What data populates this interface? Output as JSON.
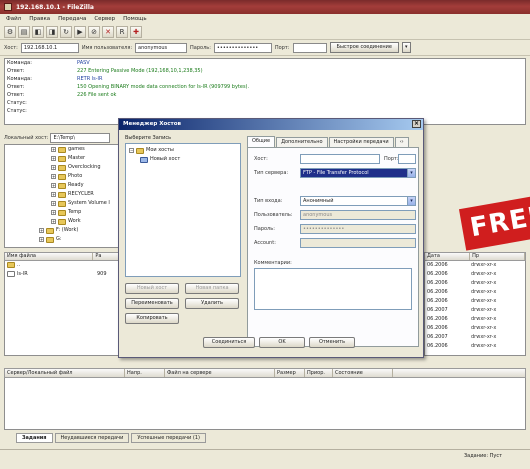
{
  "window": {
    "title": "192.168.10.1 - FileZilla"
  },
  "menu": [
    "Файл",
    "Правка",
    "Передача",
    "Сервер",
    "Помощь"
  ],
  "quickconnect": {
    "host_label": "Хост:",
    "host_value": "192.168.10.1",
    "user_label": "Имя пользователя:",
    "user_value": "anonymous",
    "pass_label": "Пароль:",
    "pass_value": "••••••••••••••",
    "port_label": "Порт:",
    "port_value": "",
    "button": "Быстрое соединение"
  },
  "log": [
    {
      "k": "Команда:",
      "v": "PASV",
      "c": "b"
    },
    {
      "k": "Ответ:",
      "v": "227 Entering Passive Mode (192,168,10,1,238,35)",
      "c": "g"
    },
    {
      "k": "Команда:",
      "v": "RETR ls-lR",
      "c": "b"
    },
    {
      "k": "Ответ:",
      "v": "150 Opening BINARY mode data connection for ls-lR (909799 bytes).",
      "c": "g"
    },
    {
      "k": "Ответ:",
      "v": "226 File sent ok",
      "c": "g"
    },
    {
      "k": "Статус:",
      "v": "",
      "c": "d"
    },
    {
      "k": "Статус:",
      "v": "",
      "c": "d"
    }
  ],
  "local": {
    "label": "Локальный хост:",
    "path": "E:\\Temp\\",
    "tree": [
      {
        "name": "games",
        "indent": 2
      },
      {
        "name": "Master",
        "indent": 2
      },
      {
        "name": "Overclocking",
        "indent": 2
      },
      {
        "name": "Photo",
        "indent": 2
      },
      {
        "name": "Ready",
        "indent": 2
      },
      {
        "name": "RECYCLER",
        "indent": 2
      },
      {
        "name": "System Volume I",
        "indent": 2
      },
      {
        "name": "Temp",
        "indent": 2
      },
      {
        "name": "Work",
        "indent": 2
      },
      {
        "name": "F: (Work)",
        "indent": 1
      },
      {
        "name": "G:",
        "indent": 1
      }
    ],
    "columns": [
      "Имя файла",
      "Ра"
    ],
    "files": [
      {
        "name": "..",
        "size": ""
      },
      {
        "name": "ls-lR",
        "size": "909"
      }
    ]
  },
  "remote": {
    "columns": [
      "Дата",
      "Пр"
    ],
    "rows": [
      {
        "d": "06.2006",
        "p": "drwxr-xr-x"
      },
      {
        "d": "06.2006",
        "p": "drwxr-xr-x"
      },
      {
        "d": "06.2006",
        "p": "drwxr-xr-x"
      },
      {
        "d": "06.2006",
        "p": "drwxr-xr-x"
      },
      {
        "d": "06.2006",
        "p": "drwxr-xr-x"
      },
      {
        "d": "06.2007",
        "p": "drwxr-xr-x"
      },
      {
        "d": "06.2006",
        "p": "drwxr-xr-x"
      },
      {
        "d": "06.2006",
        "p": "drwxr-xr-x"
      },
      {
        "d": "06.2007",
        "p": "drwxr-xr-x"
      },
      {
        "d": "06.2006",
        "p": "drwxr-xr-x"
      }
    ]
  },
  "dialog": {
    "title": "Менеджер Хостов",
    "select_label": "Выберите Запись",
    "tree_root": "Мои хосты",
    "tree_child": "Новый хост",
    "buttons": {
      "new_site": "Новый хост",
      "new_folder": "Новая папка",
      "rename": "Переименовать",
      "delete": "Удалить",
      "copy": "Копировать",
      "connect": "Соединиться",
      "ok": "OK",
      "cancel": "Отменить"
    },
    "tabs": [
      "Общие",
      "Дополнительно",
      "Настройки передачи"
    ],
    "fields": {
      "host_label": "Хост:",
      "port_label": "Порт:",
      "server_type_label": "Тип сервера:",
      "server_type_value": "FTP - File Transfer Protocol",
      "logon_type_label": "Тип входа:",
      "logon_type_value": "Анонимный",
      "user_label": "Пользователь:",
      "user_value": "anonymous",
      "pass_label": "Пароль:",
      "pass_value": "••••••••••••••",
      "account_label": "Account:",
      "comments_label": "Комментарии:"
    }
  },
  "queue": {
    "columns": [
      "Сервер/Локальный файл",
      "Напр.",
      "Файл на сервере",
      "Размер",
      "Приор.",
      "Состояние"
    ],
    "tabs": [
      "Задания",
      "Неудавшиеся передачи",
      "Успешные передачи (1)"
    ],
    "status": "Задание: Пуст"
  },
  "stamp": "FREE"
}
